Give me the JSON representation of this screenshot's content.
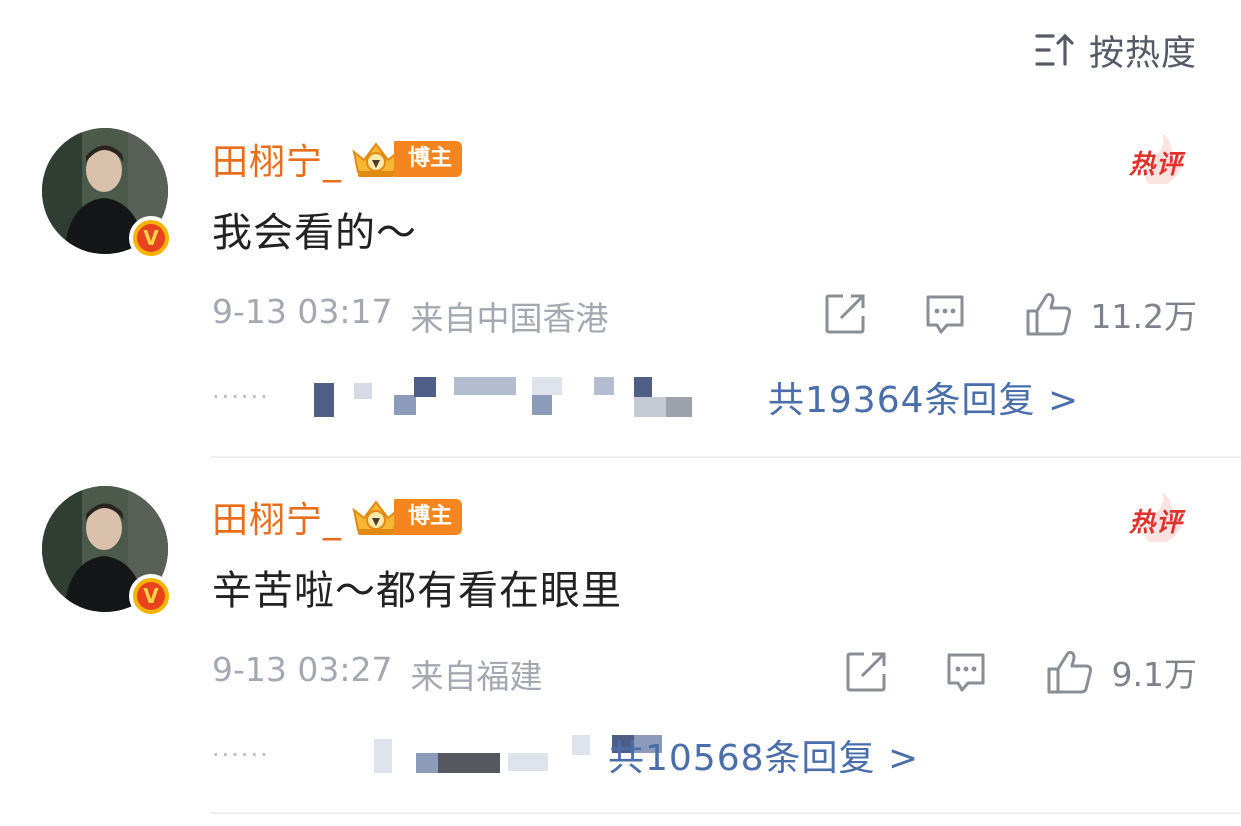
{
  "sort": {
    "label": "按热度",
    "icon": "sort-by-hot-icon"
  },
  "comments": [
    {
      "username": "田栩宁_",
      "badge_label": "博主",
      "hot_tag": "热评",
      "text": "我会看的～",
      "date": "9-13 03:17",
      "location": "来自中国香港",
      "likes": "11.2万",
      "replies_label": "共19364条回复 >"
    },
    {
      "username": "田栩宁_",
      "badge_label": "博主",
      "hot_tag": "热评",
      "text": "辛苦啦～都有看在眼里",
      "date": "9-13 03:27",
      "location": "来自福建",
      "likes": "9.1万",
      "replies_label": "共10568条回复 >"
    }
  ],
  "colors": {
    "username": "#e86e1b",
    "link": "#4a6ea9",
    "meta": "#a4a9b1",
    "hot": "#e0322d"
  }
}
